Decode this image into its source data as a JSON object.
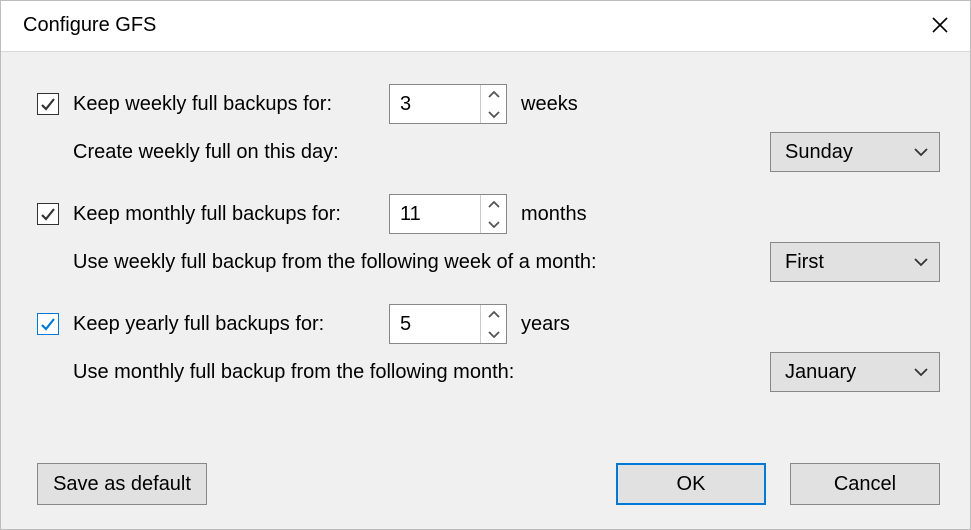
{
  "title": "Configure GFS",
  "weekly": {
    "checked": true,
    "label": "Keep weekly full backups for:",
    "value": "3",
    "unit": "weeks",
    "subLabel": "Create weekly full on this day:",
    "dropdown": "Sunday"
  },
  "monthly": {
    "checked": true,
    "label": "Keep monthly full backups for:",
    "value": "11",
    "unit": "months",
    "subLabel": "Use weekly full backup from the following week of a month:",
    "dropdown": "First"
  },
  "yearly": {
    "checked": true,
    "label": "Keep yearly full backups for:",
    "value": "5",
    "unit": "years",
    "subLabel": "Use monthly full backup from the following month:",
    "dropdown": "January"
  },
  "buttons": {
    "save": "Save as default",
    "ok": "OK",
    "cancel": "Cancel"
  }
}
